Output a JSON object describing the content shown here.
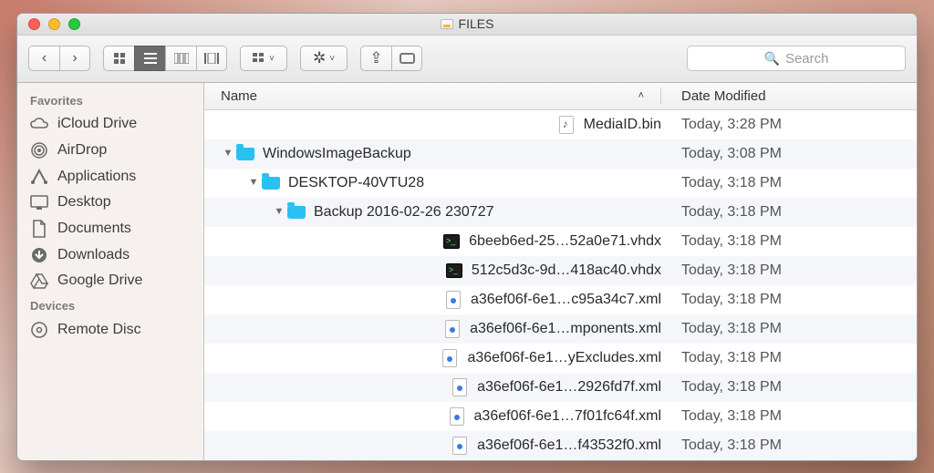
{
  "window": {
    "title": "FILES"
  },
  "toolbar": {
    "search_placeholder": "Search"
  },
  "sidebar": {
    "favorites_header": "Favorites",
    "devices_header": "Devices",
    "items": [
      {
        "label": "iCloud Drive",
        "icon": "cloud"
      },
      {
        "label": "AirDrop",
        "icon": "airdrop"
      },
      {
        "label": "Applications",
        "icon": "apps"
      },
      {
        "label": "Desktop",
        "icon": "desktop"
      },
      {
        "label": "Documents",
        "icon": "documents"
      },
      {
        "label": "Downloads",
        "icon": "downloads"
      },
      {
        "label": "Google Drive",
        "icon": "gdrive"
      }
    ],
    "device_items": [
      {
        "label": "Remote Disc",
        "icon": "remotedisc"
      }
    ]
  },
  "columns": {
    "name": "Name",
    "date": "Date Modified"
  },
  "files": [
    {
      "name": "MediaID.bin",
      "date": "Today, 3:28 PM",
      "depth": 0,
      "icon": "bin",
      "disclosure": "none"
    },
    {
      "name": "WindowsImageBackup",
      "date": "Today, 3:08 PM",
      "depth": 0,
      "icon": "folder",
      "disclosure": "open"
    },
    {
      "name": "DESKTOP-40VTU28",
      "date": "Today, 3:18 PM",
      "depth": 1,
      "icon": "folder",
      "disclosure": "open"
    },
    {
      "name": "Backup 2016-02-26 230727",
      "date": "Today, 3:18 PM",
      "depth": 2,
      "icon": "folder",
      "disclosure": "open"
    },
    {
      "name": "6beeb6ed-25…52a0e71.vhdx",
      "date": "Today, 3:18 PM",
      "depth": 3,
      "icon": "vhdx",
      "disclosure": "none"
    },
    {
      "name": "512c5d3c-9d…418ac40.vhdx",
      "date": "Today, 3:18 PM",
      "depth": 3,
      "icon": "vhdx",
      "disclosure": "none"
    },
    {
      "name": "a36ef06f-6e1…c95a34c7.xml",
      "date": "Today, 3:18 PM",
      "depth": 3,
      "icon": "xml",
      "disclosure": "none"
    },
    {
      "name": "a36ef06f-6e1…mponents.xml",
      "date": "Today, 3:18 PM",
      "depth": 3,
      "icon": "xml",
      "disclosure": "none"
    },
    {
      "name": "a36ef06f-6e1…yExcludes.xml",
      "date": "Today, 3:18 PM",
      "depth": 3,
      "icon": "xml",
      "disclosure": "none"
    },
    {
      "name": "a36ef06f-6e1…2926fd7f.xml",
      "date": "Today, 3:18 PM",
      "depth": 3,
      "icon": "xml",
      "disclosure": "none"
    },
    {
      "name": "a36ef06f-6e1…7f01fc64f.xml",
      "date": "Today, 3:18 PM",
      "depth": 3,
      "icon": "xml",
      "disclosure": "none"
    },
    {
      "name": "a36ef06f-6e1…f43532f0.xml",
      "date": "Today, 3:18 PM",
      "depth": 3,
      "icon": "xml",
      "disclosure": "none"
    }
  ]
}
